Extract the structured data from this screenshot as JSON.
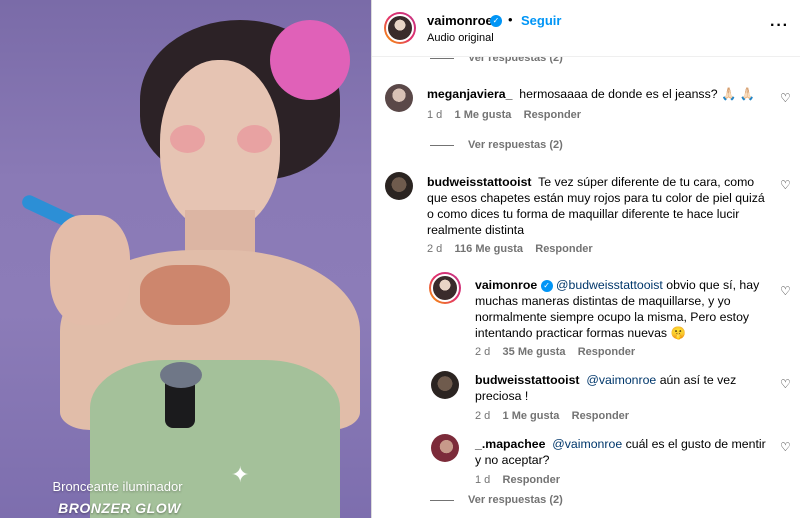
{
  "media": {
    "overlay_subtitle": "Bronceante iluminador",
    "overlay_title": "BRONZER GLOW"
  },
  "header": {
    "username": "vaimonroe",
    "separator": "•",
    "follow_label": "Seguir",
    "audio_label": "Audio original",
    "more_label": "···"
  },
  "top_partial": "Ver respuestas (2)",
  "comments": [
    {
      "username": "meganjaviera_",
      "text": "hermosaaaa de donde es el jeanss? 🙏🏻 🙏🏻",
      "time": "1 d",
      "likes": "1 Me gusta",
      "reply": "Responder",
      "replies_label": "Ver respuestas (2)"
    },
    {
      "username": "budweisstattooist",
      "text": "Te vez súper diferente de tu cara, como que esos chapetes están muy rojos para tu color de piel quizá o como dices tu forma de maquillar diferente te hace lucir realmente distinta",
      "time": "2 d",
      "likes": "116 Me gusta",
      "reply": "Responder"
    },
    {
      "username": "vaimonroe",
      "mention": "@budweisstattooist",
      "text": " obvio que sí, hay muchas maneras distintas de maquillarse, y yo normalmente siempre ocupo la misma, Pero estoy intentando practicar formas nuevas 🤫",
      "time": "2 d",
      "likes": "35 Me gusta",
      "reply": "Responder"
    },
    {
      "username": "budweisstattooist",
      "mention": "@vaimonroe",
      "text": " aún así te vez preciosa !",
      "time": "2 d",
      "likes": "1 Me gusta",
      "reply": "Responder"
    },
    {
      "username": "_.mapachee",
      "mention": "@vaimonroe",
      "text": " cuál es el gusto de mentir y no aceptar?",
      "time": "1 d",
      "reply": "Responder",
      "replies_label": "Ver respuestas (2)"
    }
  ],
  "icons": {
    "heart": "♡",
    "verified": "✓",
    "sparkle": "✦"
  },
  "colors": {
    "link_blue": "#0095f6",
    "mention": "#00376b",
    "meta_gray": "#737373"
  }
}
